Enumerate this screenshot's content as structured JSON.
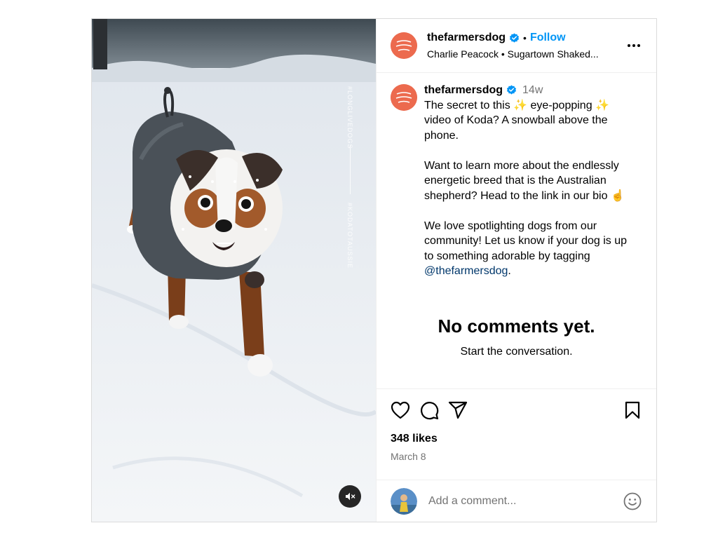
{
  "post": {
    "media": {
      "overlay_text_top": "#LONGLIVEDOGS",
      "overlay_text_bottom": "#KODATOTAUSSIE",
      "mute_icon": "speaker-muted-icon"
    },
    "header": {
      "username": "thefarmersdog",
      "separator": "•",
      "follow_label": "Follow",
      "audio_artist": "Charlie Peacock",
      "audio_sep": "•",
      "audio_title": "Sugartown Shaked...",
      "more_icon": "more-horizontal-icon"
    },
    "caption": {
      "username": "thefarmersdog",
      "time": "14w",
      "p1": "The secret to this ✨ eye-popping ✨ video of Koda? A snowball above the phone.",
      "p2": "Want to learn more about the endlessly energetic breed that is the Australian shepherd? Head to the link in our bio ☝️",
      "p3_text": "We love spotlighting dogs from our community! Let us know if your dog is up to something adorable by tagging ",
      "p3_mention": "@thefarmersdog",
      "p3_end": "."
    },
    "comments": {
      "empty_title": "No comments yet.",
      "empty_sub": "Start the conversation."
    },
    "actions": {
      "like_icon": "heart-icon",
      "comment_icon": "comment-bubble-icon",
      "share_icon": "paper-plane-icon",
      "save_icon": "bookmark-icon",
      "likes": "348 likes",
      "date": "March 8"
    },
    "comment_box": {
      "placeholder": "Add a comment...",
      "emoji_icon": "smiley-face-icon"
    },
    "colors": {
      "brand_avatar": "#ec6a4e",
      "verified_blue": "#0095f6",
      "follow_blue": "#0095f6",
      "mention_blue": "#00376b",
      "muted_text": "#737373"
    }
  }
}
